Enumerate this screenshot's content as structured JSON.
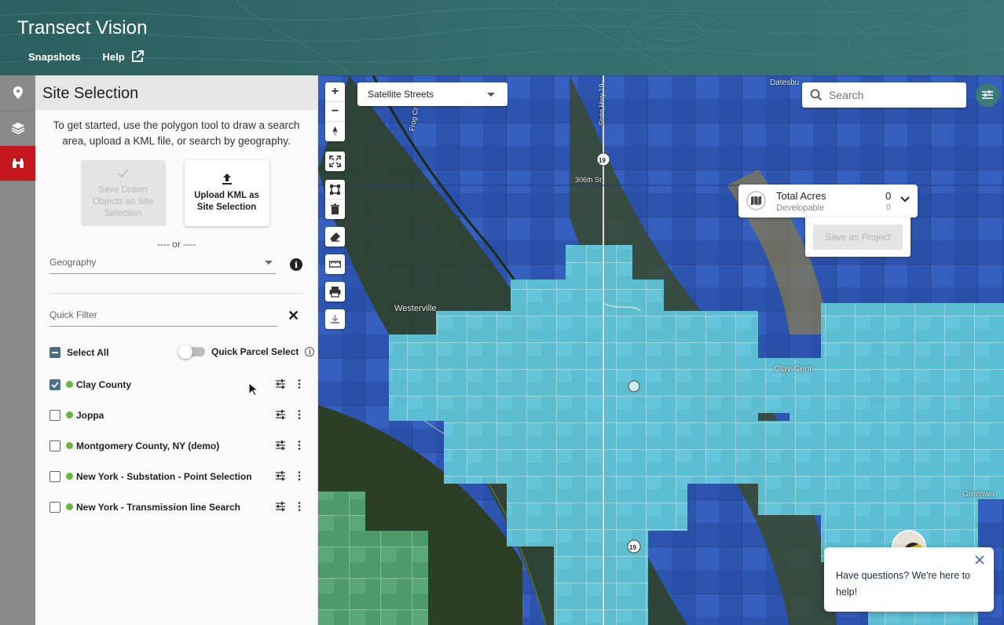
{
  "app": {
    "title": "Transect Vision"
  },
  "nav": {
    "snapshots": "Snapshots",
    "help": "Help"
  },
  "panel": {
    "title": "Site Selection",
    "intro": "To get started, use the polygon tool to draw a search area, upload a KML file, or search by geography.",
    "save_drawn_label": "Save Drawn Objects as Site Selection",
    "upload_kml_label": "Upload KML as Site Selection",
    "or_text": "---- or ----",
    "geography_placeholder": "Geography",
    "quick_filter_placeholder": "Quick Filter",
    "select_all_label": "Select All",
    "quick_parcel_label": "Quick Parcel Select",
    "items": [
      {
        "label": "Clay County",
        "checked": true
      },
      {
        "label": "Joppa",
        "checked": false
      },
      {
        "label": "Montgomery County, NY (demo)",
        "checked": false
      },
      {
        "label": "New York - Substation - Point Selection",
        "checked": false
      },
      {
        "label": "New York - Transmission line Search",
        "checked": false
      }
    ]
  },
  "map": {
    "basemap": "Satellite Streets",
    "search_placeholder": "Search",
    "acres": {
      "title": "Total Acres",
      "subtitle": "Developable",
      "value": "0",
      "developable_value": "0"
    },
    "save_project_label": "Save as Project",
    "place_labels": {
      "westerville": "Westerville",
      "clay_center": "Clay Cent",
      "state_hwy": "State Hwy 19",
      "road_306": "306th St",
      "datesburg": "Datesbu",
      "greenwood": "Greenwo",
      "county_road": "Frog Cr"
    }
  },
  "chat": {
    "message": "Have questions? We're here to help!"
  },
  "colors": {
    "brand": "#336d6c",
    "active_rail": "#c4161c",
    "parcel_fill": "#5ec8d8",
    "water_blue": "#2a55b8"
  }
}
